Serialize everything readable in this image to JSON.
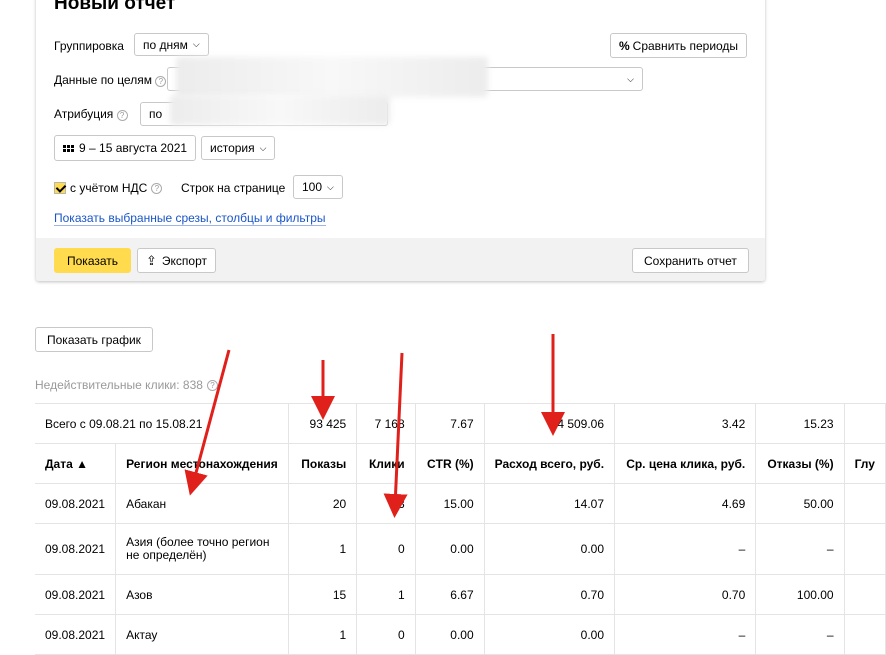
{
  "report": {
    "title": "Новый отчет",
    "grouping_label": "Группировка",
    "grouping_value": "по дням",
    "compare_label": "Сравнить периоды",
    "goals_label": "Данные по целям",
    "attribution_label": "Атрибуция",
    "attribution_value": "по",
    "date_range": "9 – 15 августа 2021",
    "history_label": "история",
    "vat_label": "с учётом НДС",
    "rows_label": "Строк на странице",
    "rows_value": "100",
    "show_selected_link": "Показать выбранные срезы, столбцы и фильтры",
    "show_button": "Показать",
    "export_button": "Экспорт",
    "save_button": "Сохранить отчет",
    "help_glyph": "?"
  },
  "show_chart_button": "Показать график",
  "invalid_clicks": "Недействительные клики: 838",
  "table": {
    "columns": [
      "Дата ▲",
      "Регион местонахождения",
      "Показы",
      "Клики",
      "CTR (%)",
      "Расход всего, руб.",
      "Ср. цена клика, руб.",
      "Отказы (%)",
      "Глу"
    ],
    "total": [
      "Всего с 09.08.21 по 15.08.21",
      "93 425",
      "7 168",
      "7.67",
      "24 509.06",
      "3.42",
      "15.23",
      ""
    ],
    "rows": [
      [
        "09.08.2021",
        "Абакан",
        "20",
        "3",
        "15.00",
        "14.07",
        "4.69",
        "50.00",
        ""
      ],
      [
        "09.08.2021",
        "Азия (более точно регион не определён)",
        "1",
        "0",
        "0.00",
        "0.00",
        "–",
        "–",
        ""
      ],
      [
        "09.08.2021",
        "Азов",
        "15",
        "1",
        "6.67",
        "0.70",
        "0.70",
        "100.00",
        ""
      ],
      [
        "09.08.2021",
        "Актау",
        "1",
        "0",
        "0.00",
        "0.00",
        "–",
        "–",
        ""
      ]
    ]
  },
  "colors": {
    "accent": "#ffdb4d",
    "link": "#1a55c7",
    "arrow": "#e0201b"
  }
}
